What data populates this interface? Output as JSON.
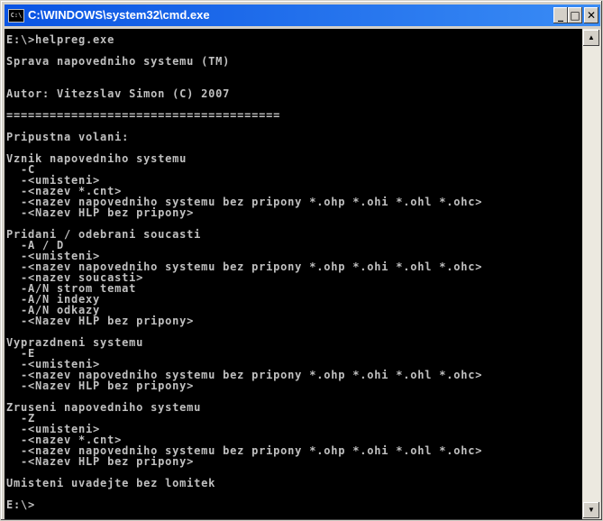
{
  "window": {
    "title": "C:\\WINDOWS\\system32\\cmd.exe",
    "icon_text": "C:\\",
    "buttons": {
      "minimize": "_",
      "maximize": "□",
      "close": "✕"
    }
  },
  "console": {
    "lines": [
      "E:\\>helpreg.exe",
      "",
      "Sprava napovedniho systemu (TM)",
      "",
      "",
      "Autor: Vitezslav Simon (C) 2007",
      "",
      "======================================",
      "",
      "Pripustna volani:",
      "",
      "Vznik napovedniho systemu",
      "  -C",
      "  -<umisteni>",
      "  -<nazev *.cnt>",
      "  -<nazev napovedniho systemu bez pripony *.ohp *.ohi *.ohl *.ohc>",
      "  -<Nazev HLP bez pripony>",
      "",
      "Pridani / odebrani soucasti",
      "  -A / D",
      "  -<umisteni>",
      "  -<nazev napovedniho systemu bez pripony *.ohp *.ohi *.ohl *.ohc>",
      "  -<nazev soucasti>",
      "  -A/N strom temat",
      "  -A/N indexy",
      "  -A/N odkazy",
      "  -<Nazev HLP bez pripony>",
      "",
      "Vyprazdneni systemu",
      "  -E",
      "  -<umisteni>",
      "  -<nazev napovedniho systemu bez pripony *.ohp *.ohi *.ohl *.ohc>",
      "  -<Nazev HLP bez pripony>",
      "",
      "Zruseni napovedniho systemu",
      "  -Z",
      "  -<umisteni>",
      "  -<nazev *.cnt>",
      "  -<nazev napovedniho systemu bez pripony *.ohp *.ohi *.ohl *.ohc>",
      "  -<Nazev HLP bez pripony>",
      "",
      "Umisteni uvadejte bez lomitek",
      "",
      "E:\\>"
    ]
  },
  "scrollbar": {
    "up": "▲",
    "down": "▼"
  }
}
